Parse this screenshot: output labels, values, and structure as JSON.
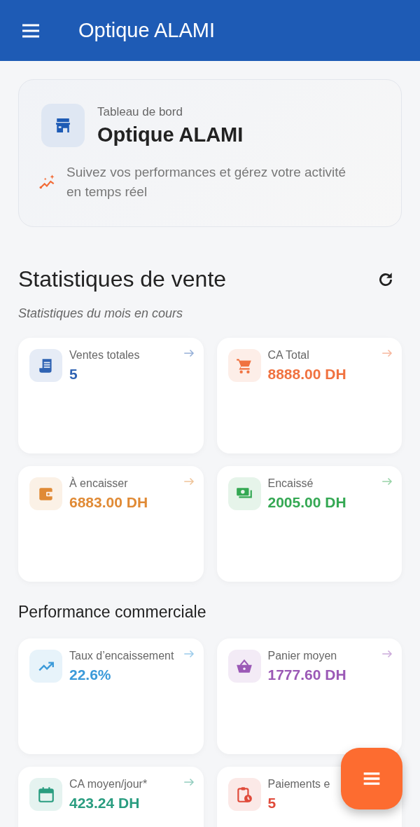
{
  "app_bar": {
    "title": "Optique ALAMI"
  },
  "hero": {
    "overline": "Tableau de bord",
    "title": "Optique ALAMI",
    "description": "Suivez vos performances et gérez votre activité en temps réel"
  },
  "sections": [
    {
      "title": "Statistiques de vente",
      "subtitle": "Statistiques du mois en cours",
      "refresh": true,
      "cards": [
        {
          "kind": "receipt",
          "label": "Ventes totales",
          "value": "5",
          "color": "#2f63b3",
          "arrow": true
        },
        {
          "kind": "cart",
          "label": "CA Total",
          "value": "8888.00 DH",
          "color": "#f07240",
          "arrow": true
        },
        {
          "kind": "wallet",
          "label": "À encaisser",
          "value": "6883.00 DH",
          "color": "#e08a35",
          "arrow": true
        },
        {
          "kind": "cash",
          "label": "Encaissé",
          "value": "2005.00 DH",
          "color": "#34a853",
          "arrow": true
        }
      ]
    },
    {
      "title": "Performance commerciale",
      "refresh": false,
      "cards": [
        {
          "kind": "trend",
          "label": "Taux d’encaissement",
          "value": "22.6%",
          "color": "#3b9ad9",
          "arrow": true
        },
        {
          "kind": "basket",
          "label": "Panier moyen",
          "value": "1777.60 DH",
          "color": "#9b59b6",
          "arrow": true
        },
        {
          "kind": "calendar",
          "label": "CA moyen/jour*",
          "value": "423.24 DH",
          "color": "#2a9d80",
          "arrow": true
        },
        {
          "kind": "clipboard",
          "label": "Paiements e",
          "value": "5",
          "color": "#e04a3a",
          "arrow": false
        }
      ]
    }
  ]
}
